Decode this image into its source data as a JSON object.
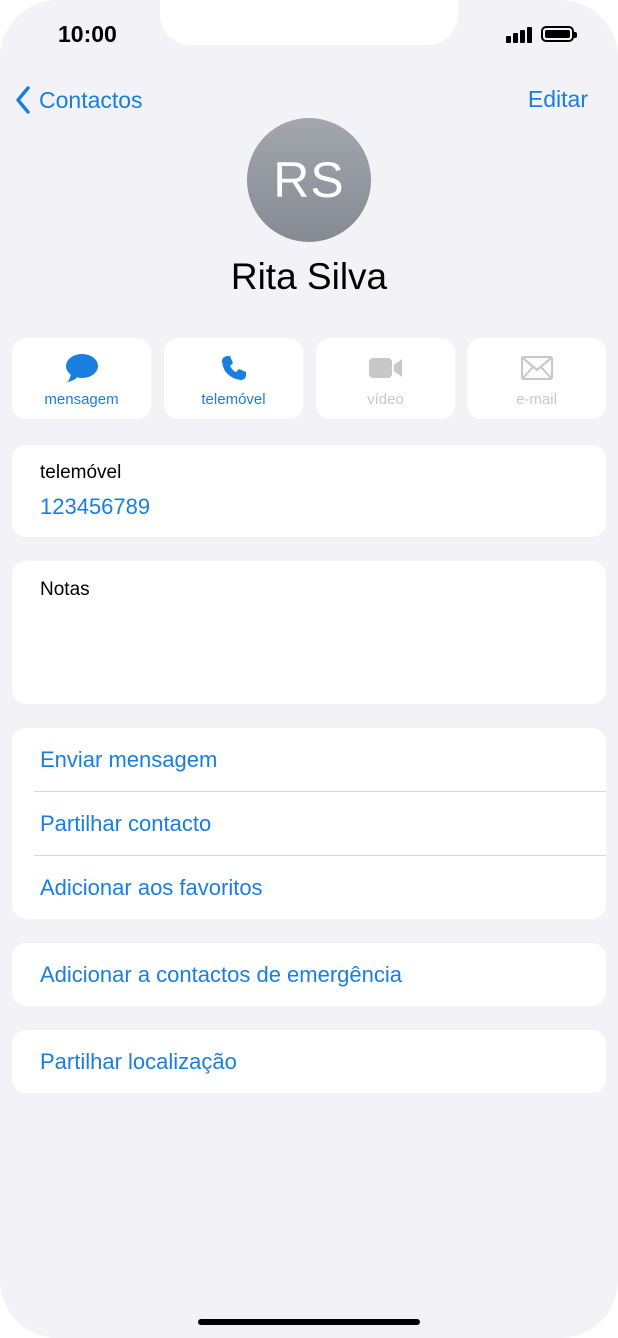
{
  "status_bar": {
    "time": "10:00"
  },
  "nav": {
    "back_label": "Contactos",
    "edit_label": "Editar"
  },
  "contact": {
    "initials": "RS",
    "name": "Rita Silva"
  },
  "actions": [
    {
      "label": "mensagem",
      "icon": "message-bubble-icon",
      "enabled": true
    },
    {
      "label": "telemóvel",
      "icon": "phone-icon",
      "enabled": true
    },
    {
      "label": "vídeo",
      "icon": "video-camera-icon",
      "enabled": false
    },
    {
      "label": "e-mail",
      "icon": "envelope-icon",
      "enabled": false
    }
  ],
  "phone": {
    "label": "telemóvel",
    "number": "123456789"
  },
  "notes": {
    "label": "Notas",
    "value": ""
  },
  "options": [
    "Enviar mensagem",
    "Partilhar contacto",
    "Adicionar aos favoritos"
  ],
  "emergency": {
    "label": "Adicionar a contactos de emergência"
  },
  "location": {
    "label": "Partilhar localização"
  },
  "colors": {
    "accent": "#1a7ee0",
    "background": "#f2f2f7",
    "disabled": "#c8c8cc"
  }
}
